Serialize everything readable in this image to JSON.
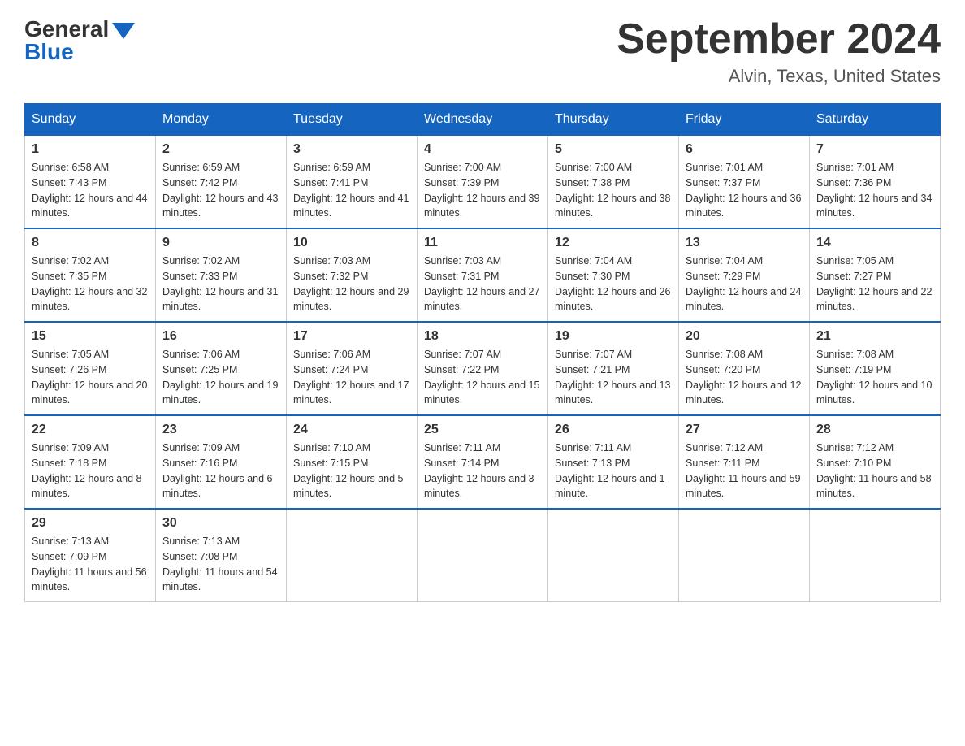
{
  "logo": {
    "general": "General",
    "blue": "Blue"
  },
  "title": "September 2024",
  "location": "Alvin, Texas, United States",
  "days_of_week": [
    "Sunday",
    "Monday",
    "Tuesday",
    "Wednesday",
    "Thursday",
    "Friday",
    "Saturday"
  ],
  "weeks": [
    [
      {
        "day": "1",
        "sunrise": "6:58 AM",
        "sunset": "7:43 PM",
        "daylight": "12 hours and 44 minutes."
      },
      {
        "day": "2",
        "sunrise": "6:59 AM",
        "sunset": "7:42 PM",
        "daylight": "12 hours and 43 minutes."
      },
      {
        "day": "3",
        "sunrise": "6:59 AM",
        "sunset": "7:41 PM",
        "daylight": "12 hours and 41 minutes."
      },
      {
        "day": "4",
        "sunrise": "7:00 AM",
        "sunset": "7:39 PM",
        "daylight": "12 hours and 39 minutes."
      },
      {
        "day": "5",
        "sunrise": "7:00 AM",
        "sunset": "7:38 PM",
        "daylight": "12 hours and 38 minutes."
      },
      {
        "day": "6",
        "sunrise": "7:01 AM",
        "sunset": "7:37 PM",
        "daylight": "12 hours and 36 minutes."
      },
      {
        "day": "7",
        "sunrise": "7:01 AM",
        "sunset": "7:36 PM",
        "daylight": "12 hours and 34 minutes."
      }
    ],
    [
      {
        "day": "8",
        "sunrise": "7:02 AM",
        "sunset": "7:35 PM",
        "daylight": "12 hours and 32 minutes."
      },
      {
        "day": "9",
        "sunrise": "7:02 AM",
        "sunset": "7:33 PM",
        "daylight": "12 hours and 31 minutes."
      },
      {
        "day": "10",
        "sunrise": "7:03 AM",
        "sunset": "7:32 PM",
        "daylight": "12 hours and 29 minutes."
      },
      {
        "day": "11",
        "sunrise": "7:03 AM",
        "sunset": "7:31 PM",
        "daylight": "12 hours and 27 minutes."
      },
      {
        "day": "12",
        "sunrise": "7:04 AM",
        "sunset": "7:30 PM",
        "daylight": "12 hours and 26 minutes."
      },
      {
        "day": "13",
        "sunrise": "7:04 AM",
        "sunset": "7:29 PM",
        "daylight": "12 hours and 24 minutes."
      },
      {
        "day": "14",
        "sunrise": "7:05 AM",
        "sunset": "7:27 PM",
        "daylight": "12 hours and 22 minutes."
      }
    ],
    [
      {
        "day": "15",
        "sunrise": "7:05 AM",
        "sunset": "7:26 PM",
        "daylight": "12 hours and 20 minutes."
      },
      {
        "day": "16",
        "sunrise": "7:06 AM",
        "sunset": "7:25 PM",
        "daylight": "12 hours and 19 minutes."
      },
      {
        "day": "17",
        "sunrise": "7:06 AM",
        "sunset": "7:24 PM",
        "daylight": "12 hours and 17 minutes."
      },
      {
        "day": "18",
        "sunrise": "7:07 AM",
        "sunset": "7:22 PM",
        "daylight": "12 hours and 15 minutes."
      },
      {
        "day": "19",
        "sunrise": "7:07 AM",
        "sunset": "7:21 PM",
        "daylight": "12 hours and 13 minutes."
      },
      {
        "day": "20",
        "sunrise": "7:08 AM",
        "sunset": "7:20 PM",
        "daylight": "12 hours and 12 minutes."
      },
      {
        "day": "21",
        "sunrise": "7:08 AM",
        "sunset": "7:19 PM",
        "daylight": "12 hours and 10 minutes."
      }
    ],
    [
      {
        "day": "22",
        "sunrise": "7:09 AM",
        "sunset": "7:18 PM",
        "daylight": "12 hours and 8 minutes."
      },
      {
        "day": "23",
        "sunrise": "7:09 AM",
        "sunset": "7:16 PM",
        "daylight": "12 hours and 6 minutes."
      },
      {
        "day": "24",
        "sunrise": "7:10 AM",
        "sunset": "7:15 PM",
        "daylight": "12 hours and 5 minutes."
      },
      {
        "day": "25",
        "sunrise": "7:11 AM",
        "sunset": "7:14 PM",
        "daylight": "12 hours and 3 minutes."
      },
      {
        "day": "26",
        "sunrise": "7:11 AM",
        "sunset": "7:13 PM",
        "daylight": "12 hours and 1 minute."
      },
      {
        "day": "27",
        "sunrise": "7:12 AM",
        "sunset": "7:11 PM",
        "daylight": "11 hours and 59 minutes."
      },
      {
        "day": "28",
        "sunrise": "7:12 AM",
        "sunset": "7:10 PM",
        "daylight": "11 hours and 58 minutes."
      }
    ],
    [
      {
        "day": "29",
        "sunrise": "7:13 AM",
        "sunset": "7:09 PM",
        "daylight": "11 hours and 56 minutes."
      },
      {
        "day": "30",
        "sunrise": "7:13 AM",
        "sunset": "7:08 PM",
        "daylight": "11 hours and 54 minutes."
      },
      null,
      null,
      null,
      null,
      null
    ]
  ]
}
